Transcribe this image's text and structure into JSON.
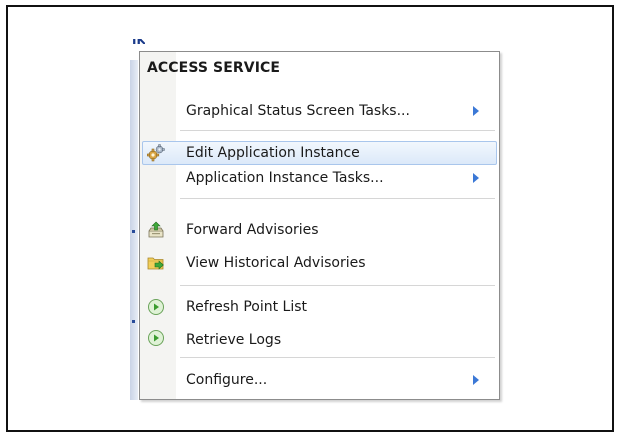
{
  "background": {
    "fragment_text": "IK"
  },
  "menu": {
    "header": "ACCESS SERVICE",
    "items": [
      {
        "label": "Graphical Status Screen Tasks...",
        "icon": "none",
        "submenu": true
      },
      {
        "label": "Edit Application Instance",
        "icon": "gear-cog-icon",
        "submenu": false,
        "highlighted": true
      },
      {
        "label": "Application Instance Tasks...",
        "icon": "none",
        "submenu": true
      },
      {
        "label": "Forward Advisories",
        "icon": "inbox-forward-icon",
        "submenu": false
      },
      {
        "label": "View Historical Advisories",
        "icon": "folder-arrow-icon",
        "submenu": false
      },
      {
        "label": "Refresh Point List",
        "icon": "green-play-circle-icon",
        "submenu": false
      },
      {
        "label": "Retrieve Logs",
        "icon": "green-play-circle-icon",
        "submenu": false
      },
      {
        "label": "Configure...",
        "icon": "none",
        "submenu": true
      }
    ]
  },
  "colors": {
    "highlight_border": "#a9c6ec",
    "highlight_fill": "#dce9f9",
    "submenu_arrow": "#3b78d6",
    "text": "#1a1a1a"
  }
}
